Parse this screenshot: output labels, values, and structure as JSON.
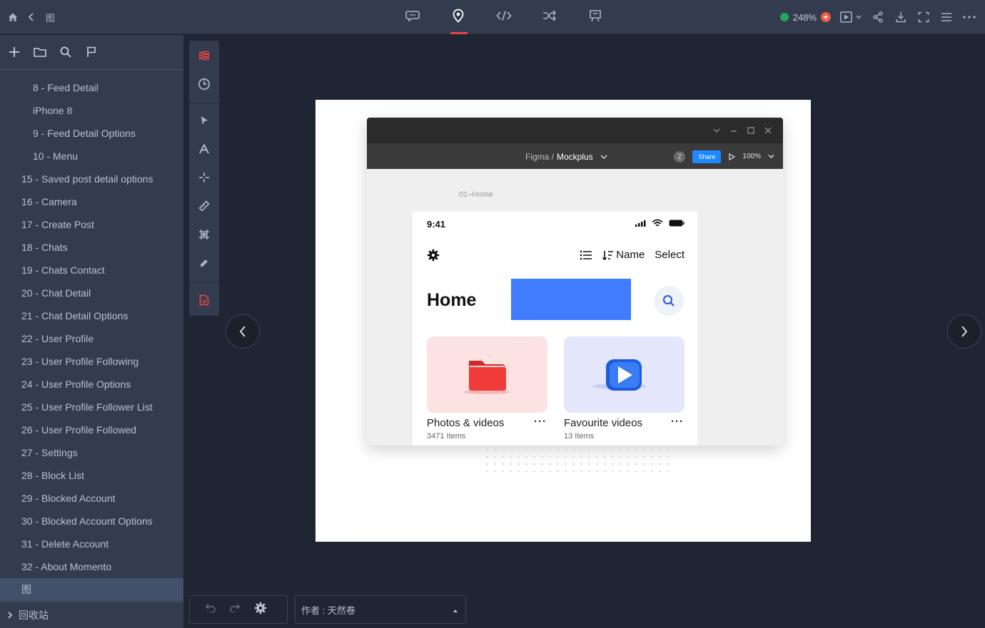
{
  "topbar": {
    "breadcrumb": "图",
    "tabs": [
      {
        "name": "comment",
        "icon": "comment-icon"
      },
      {
        "name": "inspect",
        "icon": "location-pin-icon",
        "active": true
      },
      {
        "name": "code",
        "icon": "code-icon"
      },
      {
        "name": "flow",
        "icon": "shuffle-icon"
      },
      {
        "name": "present",
        "icon": "board-icon"
      }
    ],
    "zoom": "248%",
    "status_color": "#26a65b",
    "accent_color": "#e94545"
  },
  "sidebar": {
    "items": [
      {
        "label": "8 - Feed Detail",
        "level": "child"
      },
      {
        "label": "iPhone 8",
        "level": "child"
      },
      {
        "label": "9 - Feed Detail Options",
        "level": "child"
      },
      {
        "label": "10 - Menu",
        "level": "child"
      },
      {
        "label": "15 - Saved post detail options",
        "level": "top"
      },
      {
        "label": "16 - Camera",
        "level": "top"
      },
      {
        "label": "17 - Create Post",
        "level": "top"
      },
      {
        "label": "18 - Chats",
        "level": "top"
      },
      {
        "label": "19 - Chats Contact",
        "level": "top"
      },
      {
        "label": "20 - Chat Detail",
        "level": "top"
      },
      {
        "label": "21 - Chat Detail Options",
        "level": "top"
      },
      {
        "label": "22 - User Profile",
        "level": "top"
      },
      {
        "label": "23 - User Profile Following",
        "level": "top"
      },
      {
        "label": "24 - User Profile Options",
        "level": "top"
      },
      {
        "label": "25 - User Profile Follower List",
        "level": "top"
      },
      {
        "label": "26 - User Profile Followed",
        "level": "top"
      },
      {
        "label": "27 - Settings",
        "level": "top"
      },
      {
        "label": "28 - Block List",
        "level": "top"
      },
      {
        "label": "29 - Blocked Account",
        "level": "top"
      },
      {
        "label": "30 - Blocked Account Options",
        "level": "top"
      },
      {
        "label": "31 - Delete Account",
        "level": "top"
      },
      {
        "label": "32 - About Momento",
        "level": "top"
      },
      {
        "label": "图",
        "level": "selected"
      }
    ],
    "trash_label": "回收站"
  },
  "artboard": {
    "figma_path_prefix": "Figma /",
    "figma_path_name": "Mockplus",
    "avatar_letter": "Z",
    "share_label": "Share",
    "zoom_label": "100%",
    "frame_label": "01–Home",
    "phone": {
      "time": "9:41",
      "sort_label": "Name",
      "select_label": "Select",
      "home_title": "Home",
      "brand_blue": "#3f7cff",
      "cards": [
        {
          "title": "Photos & videos",
          "count": "3471 Items"
        },
        {
          "title": "Favourite videos",
          "count": "13 Items"
        }
      ]
    }
  },
  "footer": {
    "author": "作者 : 天然卷"
  }
}
